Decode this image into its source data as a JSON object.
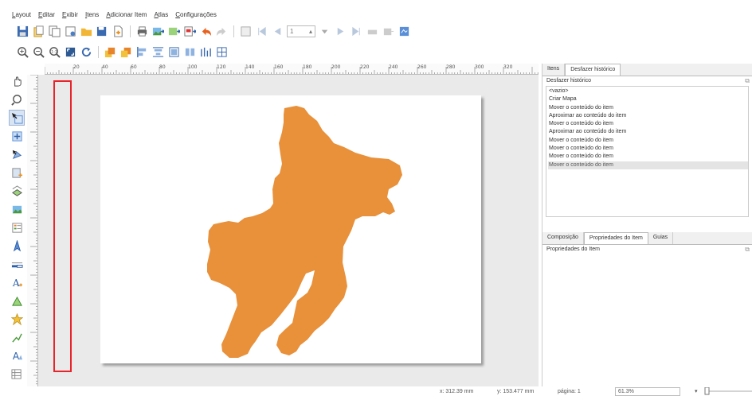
{
  "menubar": {
    "items": [
      "Layout",
      "Editar",
      "Exibir",
      "Itens",
      "Adicionar Item",
      "Atlas",
      "Configurações"
    ]
  },
  "toolbar": {
    "page_number": "1"
  },
  "ruler": {
    "h_ticks": [
      "20",
      "40",
      "60",
      "80",
      "100",
      "120",
      "140",
      "160",
      "180",
      "200",
      "220",
      "240",
      "260",
      "280",
      "300",
      "320"
    ]
  },
  "panel_top": {
    "tabs": [
      "Itens",
      "Desfazer histórico"
    ],
    "active_tab": "Desfazer histórico",
    "title": "Desfazer histórico",
    "history": [
      "<vazio>",
      "Criar Mapa",
      "Mover o conteúdo do item",
      "Aproximar ao conteúdo do item",
      "Mover o conteúdo do item",
      "Aproximar ao conteúdo do item",
      "Mover o conteúdo do item",
      "Mover o conteúdo do item",
      "Mover o conteúdo do item",
      "Mover o conteúdo do item"
    ],
    "selected_index": 9
  },
  "panel_bottom": {
    "tabs": [
      "Composição",
      "Propriedades do Item",
      "Guias"
    ],
    "active_tab": "Propriedades do Item",
    "title": "Propriedades do Item"
  },
  "statusbar": {
    "x_coord": "x: 312.39 mm",
    "y_coord": "y: 153.477 mm",
    "page": "página: 1",
    "zoom": "61.3%"
  },
  "colors": {
    "shape_fill": "#e8913a",
    "highlight": "#e8242b"
  }
}
